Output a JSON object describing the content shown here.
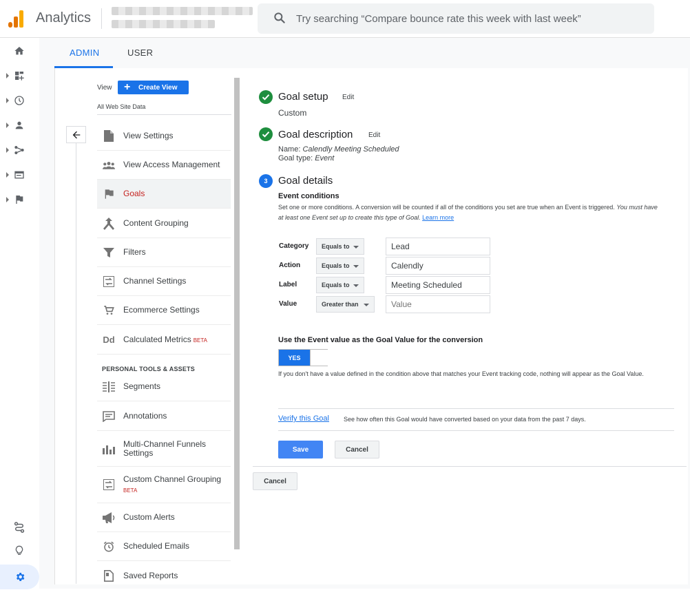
{
  "app": {
    "title": "Analytics"
  },
  "search": {
    "placeholder": "Try searching “Compare bounce rate this week with last week”"
  },
  "tabs": {
    "admin": "ADMIN",
    "user": "USER"
  },
  "view": {
    "label": "View",
    "create_button": "Create View",
    "name": "All Web Site Data"
  },
  "menu": {
    "items": [
      {
        "label": "View Settings",
        "icon": "document-icon"
      },
      {
        "label": "View Access Management",
        "icon": "people-icon"
      },
      {
        "label": "Goals",
        "icon": "flag-icon",
        "active": true
      },
      {
        "label": "Content Grouping",
        "icon": "content-grouping-icon"
      },
      {
        "label": "Filters",
        "icon": "filter-icon"
      },
      {
        "label": "Channel Settings",
        "icon": "channel-settings-icon"
      },
      {
        "label": "Ecommerce Settings",
        "icon": "cart-icon"
      },
      {
        "label": "Calculated Metrics",
        "badge": "BETA",
        "icon": "dd-icon"
      }
    ],
    "section_heading": "PERSONAL TOOLS & ASSETS",
    "tools": [
      {
        "label": "Segments",
        "icon": "segments-icon"
      },
      {
        "label": "Annotations",
        "icon": "annotation-icon"
      },
      {
        "label": "Multi-Channel Funnels",
        "label2": "Settings",
        "icon": "bar-chart-icon"
      },
      {
        "label": "Custom Channel Grouping",
        "badge": "BETA",
        "icon": "channel-grouping-icon"
      },
      {
        "label": "Custom Alerts",
        "icon": "megaphone-icon"
      },
      {
        "label": "Scheduled Emails",
        "icon": "alarm-icon"
      },
      {
        "label": "Saved Reports",
        "icon": "saved-report-icon"
      }
    ]
  },
  "goal": {
    "setup": {
      "title": "Goal setup",
      "edit": "Edit",
      "value": "Custom"
    },
    "description": {
      "title": "Goal description",
      "edit": "Edit",
      "name_label": "Name:",
      "name_value": "Calendly Meeting Scheduled",
      "type_label": "Goal type:",
      "type_value": "Event"
    },
    "details": {
      "step": "3",
      "title": "Goal details",
      "conditions_title": "Event conditions",
      "conditions_desc": "Set one or more conditions. A conversion will be counted if all of the conditions you set are true when an Event is triggered.",
      "conditions_desc_italic": "You must have at least one Event set up to create this type of Goal.",
      "learn_more": "Learn more",
      "conditions": [
        {
          "label": "Category",
          "operator": "Equals to",
          "value": "Lead",
          "placeholder": ""
        },
        {
          "label": "Action",
          "operator": "Equals to",
          "value": "Calendly",
          "placeholder": ""
        },
        {
          "label": "Label",
          "operator": "Equals to",
          "value": "Meeting Scheduled",
          "placeholder": ""
        },
        {
          "label": "Value",
          "operator": "Greater than",
          "value": "",
          "placeholder": "Value"
        }
      ],
      "use_event_value": "Use the Event value as the Goal Value for the conversion",
      "toggle": "YES",
      "toggle_help": "If you don't have a value defined in the condition above that matches your Event tracking code, nothing will appear as the Goal Value.",
      "verify_link": "Verify this Goal",
      "verify_desc": "See how often this Goal would have converted based on your data from the past 7 days.",
      "save": "Save",
      "cancel": "Cancel"
    },
    "cancel_outer": "Cancel"
  },
  "colors": {
    "accent": "#1a73e8",
    "success": "#1e8e3e",
    "active_text": "#c5221f"
  }
}
